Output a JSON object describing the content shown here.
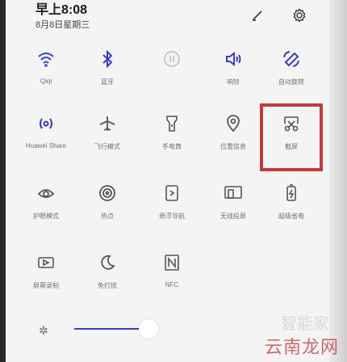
{
  "status": {
    "time": "早上8:08",
    "date": "8月8日星期三"
  },
  "header": {
    "edit_icon": "pencil-icon",
    "settings_icon": "gear-icon"
  },
  "tiles": [
    {
      "label": "Qiqi",
      "icon": "wifi-icon",
      "state": "active"
    },
    {
      "label": "蓝牙",
      "icon": "bluetooth-icon",
      "state": "active"
    },
    {
      "label": "",
      "icon": "toggle-icon",
      "state": "dim"
    },
    {
      "label": "响铃",
      "icon": "sound-icon",
      "state": "active"
    },
    {
      "label": "自动旋转",
      "icon": "rotate-icon",
      "state": "active"
    },
    {
      "label": "Huawei Share",
      "icon": "share-icon",
      "state": "active"
    },
    {
      "label": "飞行模式",
      "icon": "airplane-icon",
      "state": "inactive"
    },
    {
      "label": "手电筒",
      "icon": "flashlight-icon",
      "state": "inactive"
    },
    {
      "label": "位置信息",
      "icon": "location-icon",
      "state": "inactive"
    },
    {
      "label": "截屏",
      "icon": "screenshot-icon",
      "state": "inactive"
    },
    {
      "label": "护眼模式",
      "icon": "eye-icon",
      "state": "inactive"
    },
    {
      "label": "热点",
      "icon": "hotspot-icon",
      "state": "inactive"
    },
    {
      "label": "悬浮导航",
      "icon": "nav-icon",
      "state": "inactive"
    },
    {
      "label": "无线投屏",
      "icon": "cast-icon",
      "state": "inactive"
    },
    {
      "label": "超级省电",
      "icon": "battery-icon",
      "state": "inactive"
    },
    {
      "label": "屏幕录制",
      "icon": "record-icon",
      "state": "inactive"
    },
    {
      "label": "免打扰",
      "icon": "moon-icon",
      "state": "inactive"
    },
    {
      "label": "NFC",
      "icon": "nfc-icon",
      "state": "inactive"
    }
  ],
  "brightness": {
    "level": 0.25,
    "icon": "brightness-icon"
  },
  "watermark": {
    "text": "云南龙网",
    "faint_text": "智能家"
  }
}
